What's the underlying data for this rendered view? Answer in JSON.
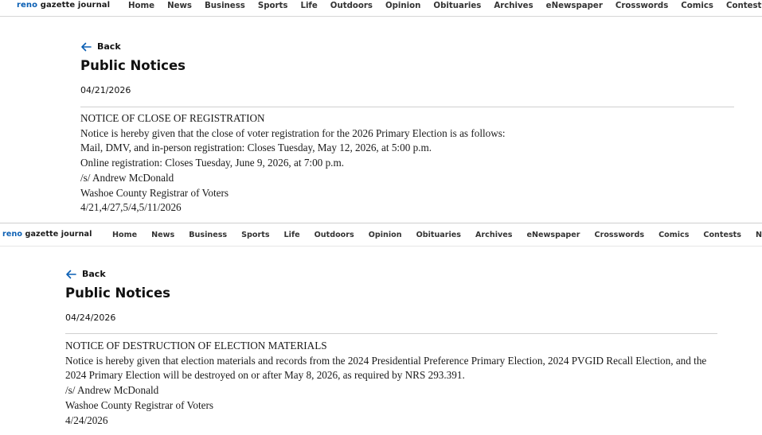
{
  "brand": {
    "name_part1": "reno",
    "name_part2": " gazette journal",
    "accent_color": "#0a5fb4"
  },
  "nav": [
    "Home",
    "News",
    "Business",
    "Sports",
    "Life",
    "Outdoors",
    "Opinion",
    "Obituaries",
    "Archives",
    "eNewspaper",
    "Crosswords",
    "Comics",
    "Contests",
    "Newsletters"
  ],
  "notices": [
    {
      "back_label": "Back",
      "page_title": "Public Notices",
      "date": "04/21/2026",
      "lines": [
        "NOTICE OF CLOSE OF REGISTRATION",
        "Notice is hereby given that the close of voter registration for the 2026 Primary Election is as follows:",
        "Mail, DMV, and in-person registration: Closes Tuesday, May 12, 2026, at 5:00 p.m.",
        "Online registration: Closes Tuesday, June 9, 2026, at 7:00 p.m.",
        "/s/ Andrew McDonald",
        "Washoe County Registrar of Voters",
        "4/21,4/27,5/4,5/11/2026"
      ]
    },
    {
      "back_label": "Back",
      "page_title": "Public Notices",
      "date": "04/24/2026",
      "lines": [
        "NOTICE OF DESTRUCTION OF ELECTION MATERIALS",
        "Notice is hereby given that election materials and records from the 2024 Presidential Preference Primary Election, 2024 PVGID Recall Election, and the 2024 Primary Election will be destroyed on or after May 8, 2026, as required by NRS 293.391.",
        "/s/ Andrew McDonald",
        "Washoe County Registrar of Voters",
        "4/24/2026"
      ]
    }
  ]
}
